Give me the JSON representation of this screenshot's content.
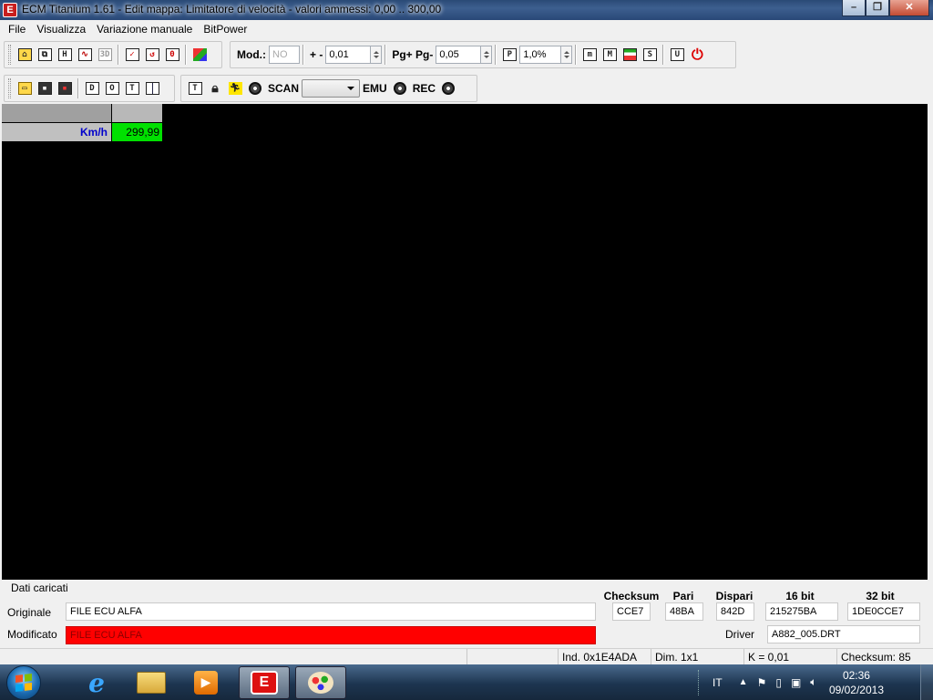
{
  "window": {
    "title": "ECM Titanium 1.61 - Edit mappa: Limitatore di velocità - valori ammessi: 0,00 .. 300,00",
    "minimize_icon": "minimize-icon",
    "restore_icon": "restore-icon",
    "close_icon": "close-icon"
  },
  "menu": [
    "File",
    "Visualizza",
    "Variazione manuale",
    "BitPower"
  ],
  "toolbar1": {
    "mod_label": "Mod.:",
    "mod_value": "NO",
    "plusminus_label": "+ -",
    "plusminus_value": "0,01",
    "pg_label": "Pg+ Pg-",
    "pg_value": "0,05",
    "percent_value": "1,0%",
    "icons": [
      "home-icon",
      "copy-maps-icon",
      "hex-view-icon",
      "graph-2d-icon",
      "graph-3d-icon",
      "check-icon",
      "undo-icon",
      "zero-icon",
      "compare-icon",
      "p-icon",
      "m-small-icon",
      "m-icon",
      "table-icon",
      "s-icon",
      "u-icon",
      "power-icon"
    ]
  },
  "toolbar2": {
    "scan_label": "SCAN",
    "scan_value": "",
    "emu_label": "EMU",
    "rec_label": "REC",
    "icons": [
      "open-folder-icon",
      "save-icon",
      "save-as-icon",
      "d-icon",
      "o-icon",
      "t-icon",
      "columns-icon",
      "t-tool-icon",
      "lock-icon",
      "run-icon",
      "scan-record-icon",
      "emu-record-icon",
      "rec-record-icon"
    ]
  },
  "map": {
    "row_label": "Km/h",
    "cell_value": "299,99",
    "cell_color": "#00e000"
  },
  "panel": {
    "title": "Dati caricati",
    "orig_label": "Originale",
    "orig_file": "FILE ECU ALFA",
    "mod_label": "Modificato",
    "mod_file": "FILE ECU ALFA",
    "mod_color": "#ff0000",
    "headers": {
      "checksum": "Checksum",
      "pari": "Pari",
      "dispari": "Dispari",
      "bit16": "16 bit",
      "bit32": "32 bit"
    },
    "values": {
      "checksum": "CCE7",
      "pari": "48BA",
      "dispari": "842D",
      "bit16": "215275BA",
      "bit32": "1DE0CCE7"
    },
    "driver_label": "Driver",
    "driver_value": "A882_005.DRT"
  },
  "status": {
    "ind": "Ind. 0x1E4ADA",
    "dim": "Dim. 1x1",
    "k": "K = 0,01",
    "checksum": "Checksum: 85"
  },
  "taskbar": {
    "lang": "IT",
    "time": "02:36",
    "date": "09/02/2013",
    "apps": [
      "internet-explorer-icon",
      "file-explorer-icon",
      "media-player-icon",
      "ecm-titanium-icon",
      "paint-icon"
    ]
  }
}
